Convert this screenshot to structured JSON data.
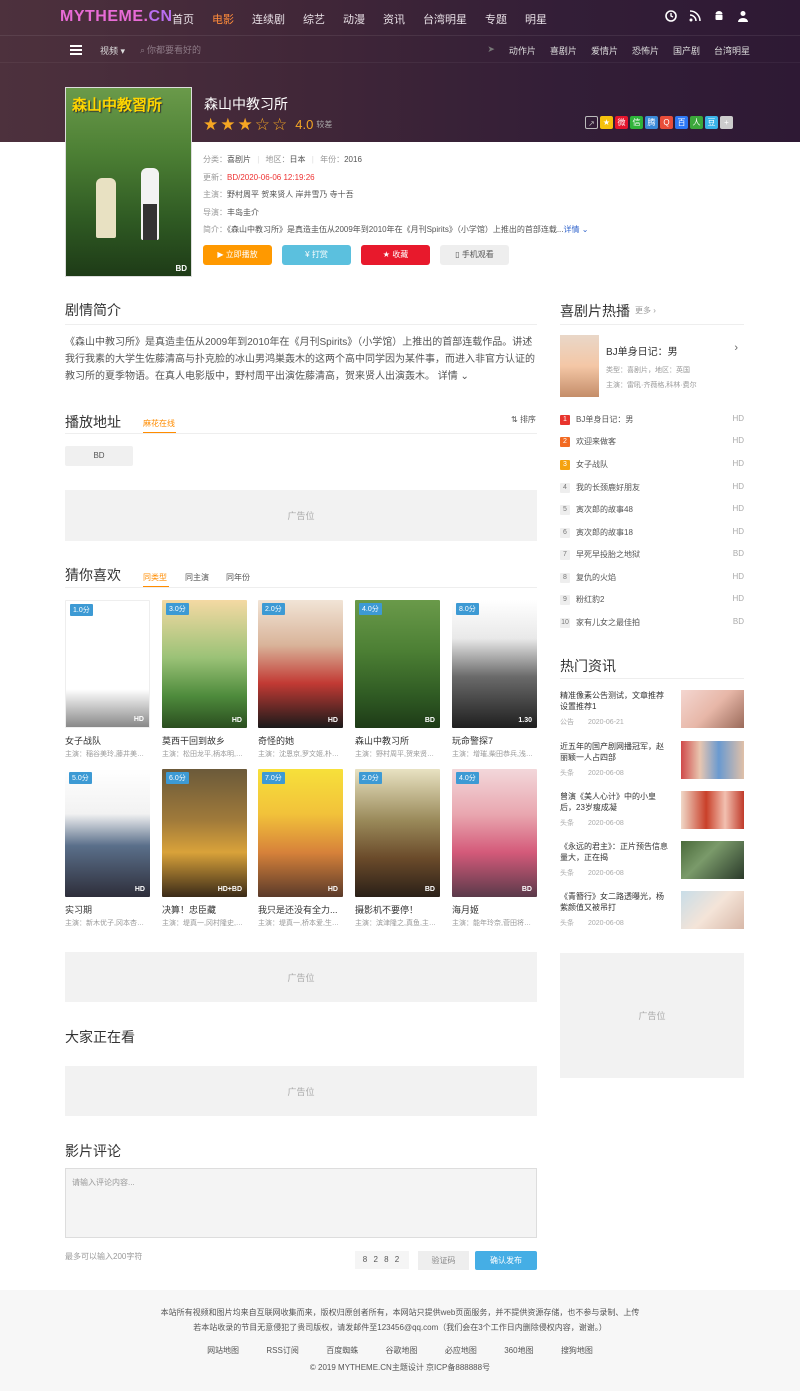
{
  "site": {
    "logo_a": "MYTHEME.",
    "logo_b": "CN"
  },
  "nav": [
    {
      "label": "首页"
    },
    {
      "label": "电影",
      "active": true
    },
    {
      "label": "连续剧"
    },
    {
      "label": "综艺"
    },
    {
      "label": "动漫"
    },
    {
      "label": "资讯"
    },
    {
      "label": "台湾明星"
    },
    {
      "label": "专题"
    },
    {
      "label": "明星"
    }
  ],
  "subnav": {
    "category": "视频 ▾",
    "search_placeholder": "你都要看好的",
    "links": [
      "动作片",
      "喜剧片",
      "爱情片",
      "恐怖片",
      "国产剧",
      "台湾明星"
    ]
  },
  "movie": {
    "poster_title": "森山中教習所",
    "poster_quality": "BD",
    "title": "森山中教习所",
    "score": "4.0",
    "rating_word": "较差",
    "rating_value": 4,
    "rating_max": 5,
    "category_label": "分类：",
    "category": "喜剧片",
    "region_label": "地区：",
    "region": "日本",
    "year_label": "年份：",
    "year": "2016",
    "update_label": "更新：",
    "update": "BD/2020-06-06 12:19:26",
    "actors_label": "主演：",
    "actors": "野村周平 贺来贤人 岸井雪乃 寺十吾",
    "director_label": "导演：",
    "director": "丰岛圭介",
    "intro_label": "简介：",
    "intro": "《森山中教习所》是真造圭伍从2009年到2010年在《月刊Spirits》（小学馆）上推出的首部连载...",
    "detail_link": "详情 ⌄"
  },
  "buttons": {
    "play": "▶ 立即播放",
    "tip": "¥ 打赏",
    "fav": "★ 收藏",
    "mobile": "▯ 手机观看"
  },
  "synopsis": {
    "title": "剧情简介",
    "text": "《森山中教习所》是真造圭伍从2009年到2010年在《月刊Spirits》（小学馆）上推出的首部连载作品。讲述我行我素的大学生佐藤清高与扑克脸的冰山男鸿巣轰木的这两个高中同学因为某件事，而进入非官方认证的教习所的夏季物语。在真人电影版中，野村周平出演佐藤清高，贺来贤人出演轰木。",
    "more": "详情 ⌄"
  },
  "play": {
    "title": "播放地址",
    "source": "麻花在线",
    "sort": "排序",
    "episode": "BD"
  },
  "ad": {
    "label": "广告位"
  },
  "guess": {
    "title": "猜你喜欢",
    "tabs": [
      "同类型",
      "同主演",
      "同年份"
    ],
    "cards": [
      {
        "score": "1.0分",
        "quality": "HD",
        "name": "女子战队",
        "actors": "主演：稲谷美玲,藤井美琪,..."
      },
      {
        "score": "3.0分",
        "quality": "HD",
        "name": "莫西干回到故乡",
        "actors": "主演：松田龙平,柄本明,前..."
      },
      {
        "score": "2.0分",
        "quality": "HD",
        "name": "奇怪的她",
        "actors": "主演：沈恩京,罗文姬,朴仁..."
      },
      {
        "score": "4.0分",
        "quality": "BD",
        "name": "森山中教习所",
        "actors": "主演：野村周平,贺来贤人,..."
      },
      {
        "score": "8.0分",
        "quality": "1.30",
        "name": "玩命警探7",
        "actors": "主演：增璀,柴田恭兵,浅野..."
      },
      {
        "score": "5.0分",
        "quality": "HD",
        "name": "实习期",
        "actors": "主演：新木优子,冈本杏理,..."
      },
      {
        "score": "6.0分",
        "quality": "HD+BD",
        "name": "决算！忠臣藏",
        "actors": "主演：堤真一,冈村隆史,滨..."
      },
      {
        "score": "7.0分",
        "quality": "HD",
        "name": "我只是还没有全力...",
        "actors": "主演：堤真一,桥本爱,生濑..."
      },
      {
        "score": "2.0分",
        "quality": "BD",
        "name": "摄影机不要停！",
        "actors": "主演：滨津隆之,真鱼,主浜..."
      },
      {
        "score": "4.0分",
        "quality": "BD",
        "name": "海月姬",
        "actors": "主演：能年玲奈,菅田将晖,..."
      }
    ]
  },
  "watching": {
    "title": "大家正在看"
  },
  "comments": {
    "title": "影片评论",
    "placeholder": "请输入评论内容...",
    "hint": "最多可以输入200字符",
    "captcha": "8 2 8 2",
    "captcha_placeholder": "验证码",
    "submit": "确认发布"
  },
  "hot": {
    "title": "喜剧片热播",
    "more": "更多 ›",
    "feature": {
      "title": "BJ单身日记：男",
      "meta1": "类型：喜剧片，地区：英国",
      "meta2": "主演：雷吼·齐薇格,科林·费尔"
    },
    "items": [
      {
        "rank": "1",
        "name": "BJ单身日记：男",
        "q": "HD"
      },
      {
        "rank": "2",
        "name": "欢迎来做客",
        "q": "HD"
      },
      {
        "rank": "3",
        "name": "女子战队",
        "q": "HD"
      },
      {
        "rank": "4",
        "name": "我的长颈鹿好朋友",
        "q": "HD"
      },
      {
        "rank": "5",
        "name": "寅次郎的故事48",
        "q": "HD"
      },
      {
        "rank": "6",
        "name": "寅次郎的故事18",
        "q": "HD"
      },
      {
        "rank": "7",
        "name": "早死早投胎之地狱",
        "q": "BD"
      },
      {
        "rank": "8",
        "name": "复仇的火焰",
        "q": "HD"
      },
      {
        "rank": "9",
        "name": "粉红豹2",
        "q": "HD"
      },
      {
        "rank": "10",
        "name": "家有儿女之最佳拍",
        "q": "BD"
      }
    ]
  },
  "news": {
    "title": "热门资讯",
    "items": [
      {
        "title": "精准像素公告测试，文章推荐设置推荐1",
        "tag": "公告",
        "date": "2020-06-21"
      },
      {
        "title": "近五年的国产剧网播冠军，赵丽颖一人占四部",
        "tag": "头条",
        "date": "2020-06-08"
      },
      {
        "title": "曾演《美人心计》中的小皇后，23岁瘦成凝",
        "tag": "头条",
        "date": "2020-06-08"
      },
      {
        "title": "《永远的君主》：正片预告信息量大，正在揭",
        "tag": "头条",
        "date": "2020-06-08"
      },
      {
        "title": "《青簪行》女二路透曝光，杨紫颜值又被吊打",
        "tag": "头条",
        "date": "2020-06-08"
      }
    ]
  },
  "footer": {
    "line1": "本站所有视频和图片均来自互联网收集而来，版权归原创者所有，本网站只提供web页面服务，并不提供资源存储，也不参与录制、上传",
    "line2": "若本站收录的节目无意侵犯了贵司版权，请发邮件至123456@qq.com（我们会在3个工作日内删除侵权内容，谢谢。）",
    "links": [
      "网站地图",
      "RSS订阅",
      "百度蜘蛛",
      "谷歌地图",
      "必应地图",
      "360地图",
      "搜狗地图"
    ],
    "copyright": "© 2019 MYTHEME.CN主题设计 京ICP备888888号"
  },
  "colors": {
    "accent": "#ff8c00",
    "header_bg": "#3d2235",
    "play": "#ff9900",
    "tip": "#5bc0de",
    "fav": "#e8192c",
    "submit": "#45aee5"
  }
}
